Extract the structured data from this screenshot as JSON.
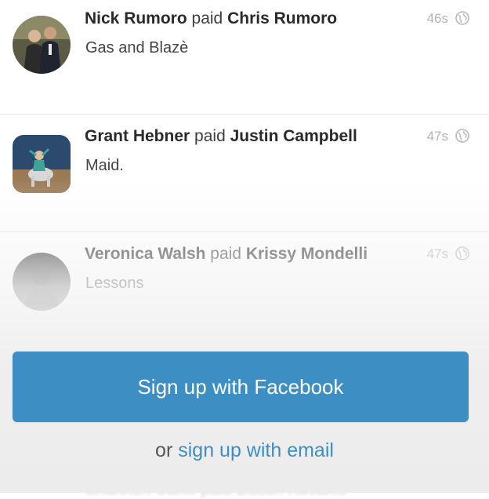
{
  "feed": {
    "items": [
      {
        "actor": "Nick Rumoro",
        "verb": "paid",
        "target": "Chris Rumoro",
        "note": "Gas and Blazè",
        "time": "46s",
        "avatar": "couple-photo"
      },
      {
        "actor": "Grant Hebner",
        "verb": "paid",
        "target": "Justin Campbell",
        "note": "Maid.",
        "time": "47s",
        "avatar": "cartoon-rider"
      },
      {
        "actor": "Veronica Walsh",
        "verb": "paid",
        "target": "Krissy Mondelli",
        "note": "Lessons",
        "time": "47s",
        "avatar": "default-silhouette"
      }
    ],
    "ghost_line": "Shannon Cahill paid Dustin Kavanis"
  },
  "cta": {
    "facebook_label": "Sign up with Facebook",
    "or_text": "or",
    "email_link": "sign up with email"
  },
  "colors": {
    "accent": "#3d8fc3",
    "time_gray": "#b2b2b2"
  },
  "icons": {
    "privacy": "globe-icon"
  }
}
